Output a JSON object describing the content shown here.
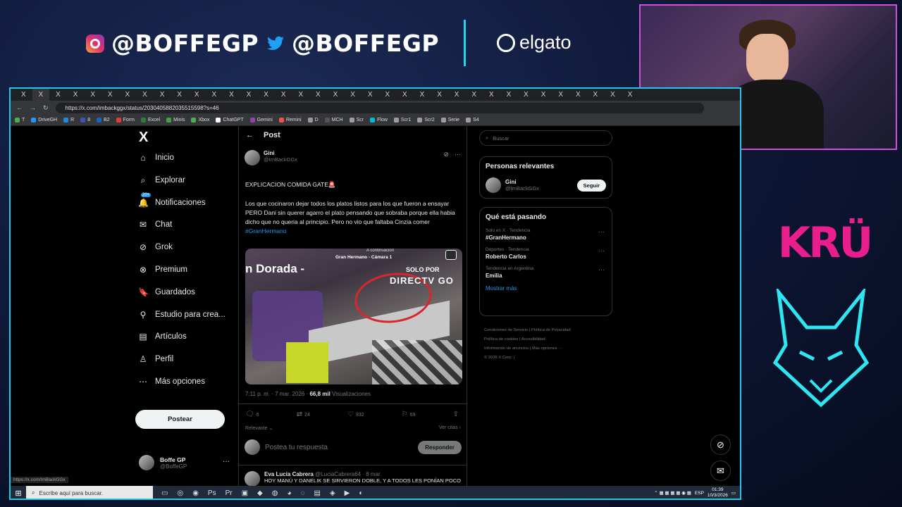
{
  "overlay": {
    "instagram": "@BOFFEGP",
    "twitter": "@BOFFEGP",
    "sponsor": "elgato",
    "team_logo": "KRÜ"
  },
  "browser": {
    "tab_glyph": "X",
    "tab_count": 36,
    "url": "https://x.com/imbackggx/status/2030405882035515598?s=46",
    "bookmarks": [
      "T",
      "DriveGH",
      "R",
      "8",
      "B2",
      "Form",
      "Excel",
      "Minis",
      "Xbox",
      "ChatGPT",
      "Gemini",
      "Remini",
      "D",
      "MCH",
      "Scr",
      "Flow",
      "Scr1",
      "Scr2",
      "Serie",
      "S4"
    ],
    "status_url": "https://x.com/ImBackGGx"
  },
  "nav": {
    "logo": "X",
    "items": [
      {
        "label": "Inicio",
        "icon": "home-icon",
        "glyph": "⌂"
      },
      {
        "label": "Explorar",
        "icon": "search-icon",
        "glyph": "⌕"
      },
      {
        "label": "Notificaciones",
        "icon": "bell-icon",
        "glyph": "🔔",
        "badge": "20+"
      },
      {
        "label": "Chat",
        "icon": "mail-icon",
        "glyph": "✉"
      },
      {
        "label": "Grok",
        "icon": "grok-icon",
        "glyph": "⊘"
      },
      {
        "label": "Premium",
        "icon": "premium-icon",
        "glyph": "⊗"
      },
      {
        "label": "Guardados",
        "icon": "bookmark-icon",
        "glyph": "🔖"
      },
      {
        "label": "Estudio para crea...",
        "icon": "studio-icon",
        "glyph": "⚲"
      },
      {
        "label": "Artículos",
        "icon": "articles-icon",
        "glyph": "▤"
      },
      {
        "label": "Perfil",
        "icon": "person-icon",
        "glyph": "♙"
      },
      {
        "label": "Más opciones",
        "icon": "more-circle-icon",
        "glyph": "⋯"
      }
    ],
    "post_button": "Postear",
    "account_name": "Boffe GP",
    "account_handle": "@BoffeGP"
  },
  "post": {
    "header": "Post",
    "author_name": "Gini",
    "author_handle": "@ImBackGGx",
    "title": "EXPLICACION COMIDA GATE🚨",
    "body": "Los que cocinaron dejar todos los platos listos para los que fueron a ensayar PERO Dani sin querer agarro el plato pensando que sobraba porque ella habia dicho que no queria al principio. Pero no vio que faltaba Cinzia comer",
    "hashtag": "#GranHermano",
    "media": {
      "overlay_title": "n Dorada -",
      "camera": "Gran Hermano - Cámara 1",
      "next_label": "A continuación",
      "solo_por": "SOLO POR",
      "brand": "DIRECTV GO"
    },
    "time": "7:11 p. m. · 7 mar. 2026 ·",
    "views": "66,8 mil",
    "views_label": "Visualizaciones",
    "replies": "6",
    "reposts": "24",
    "likes": "932",
    "bookmarks": "69",
    "relevance": "Relevante",
    "quotes": "Ver citas",
    "reply_placeholder": "Postea tu respuesta",
    "reply_button": "Responder"
  },
  "next_reply": {
    "name": "Eva Lucía Cabrera",
    "handle": "@LuciaCabrera64 · 8 mar.",
    "text": "HOY MANÚ Y DANELIK SE SIRVIERON DOBLE, Y A TODOS LES PONÍAN POCO"
  },
  "sidebar": {
    "search_placeholder": "Buscar",
    "relevant_title": "Personas relevantes",
    "relevant_name": "Gini",
    "relevant_handle": "@ImBackGGx",
    "follow_button": "Seguir",
    "trending_title": "Qué está pasando",
    "trends": [
      {
        "category": "Solo en X · Tendencia",
        "name": "#GranHermano"
      },
      {
        "category": "Deportes · Tendencia",
        "name": "Roberto Carlos"
      },
      {
        "category": "Tendencia en Argentina",
        "name": "Emilia"
      }
    ],
    "show_more": "Mostrar más",
    "footer": [
      "Condiciones de Servicio",
      "Política de Privacidad",
      "Política de cookies",
      "Accesibilidad",
      "Información de anuncios",
      "Más opciones ···",
      "© 2026 X Corp."
    ]
  },
  "taskbar": {
    "search_placeholder": "Escribe aquí para buscar.",
    "lang": "ESP",
    "time": "01:39",
    "date": "10/3/2026"
  }
}
